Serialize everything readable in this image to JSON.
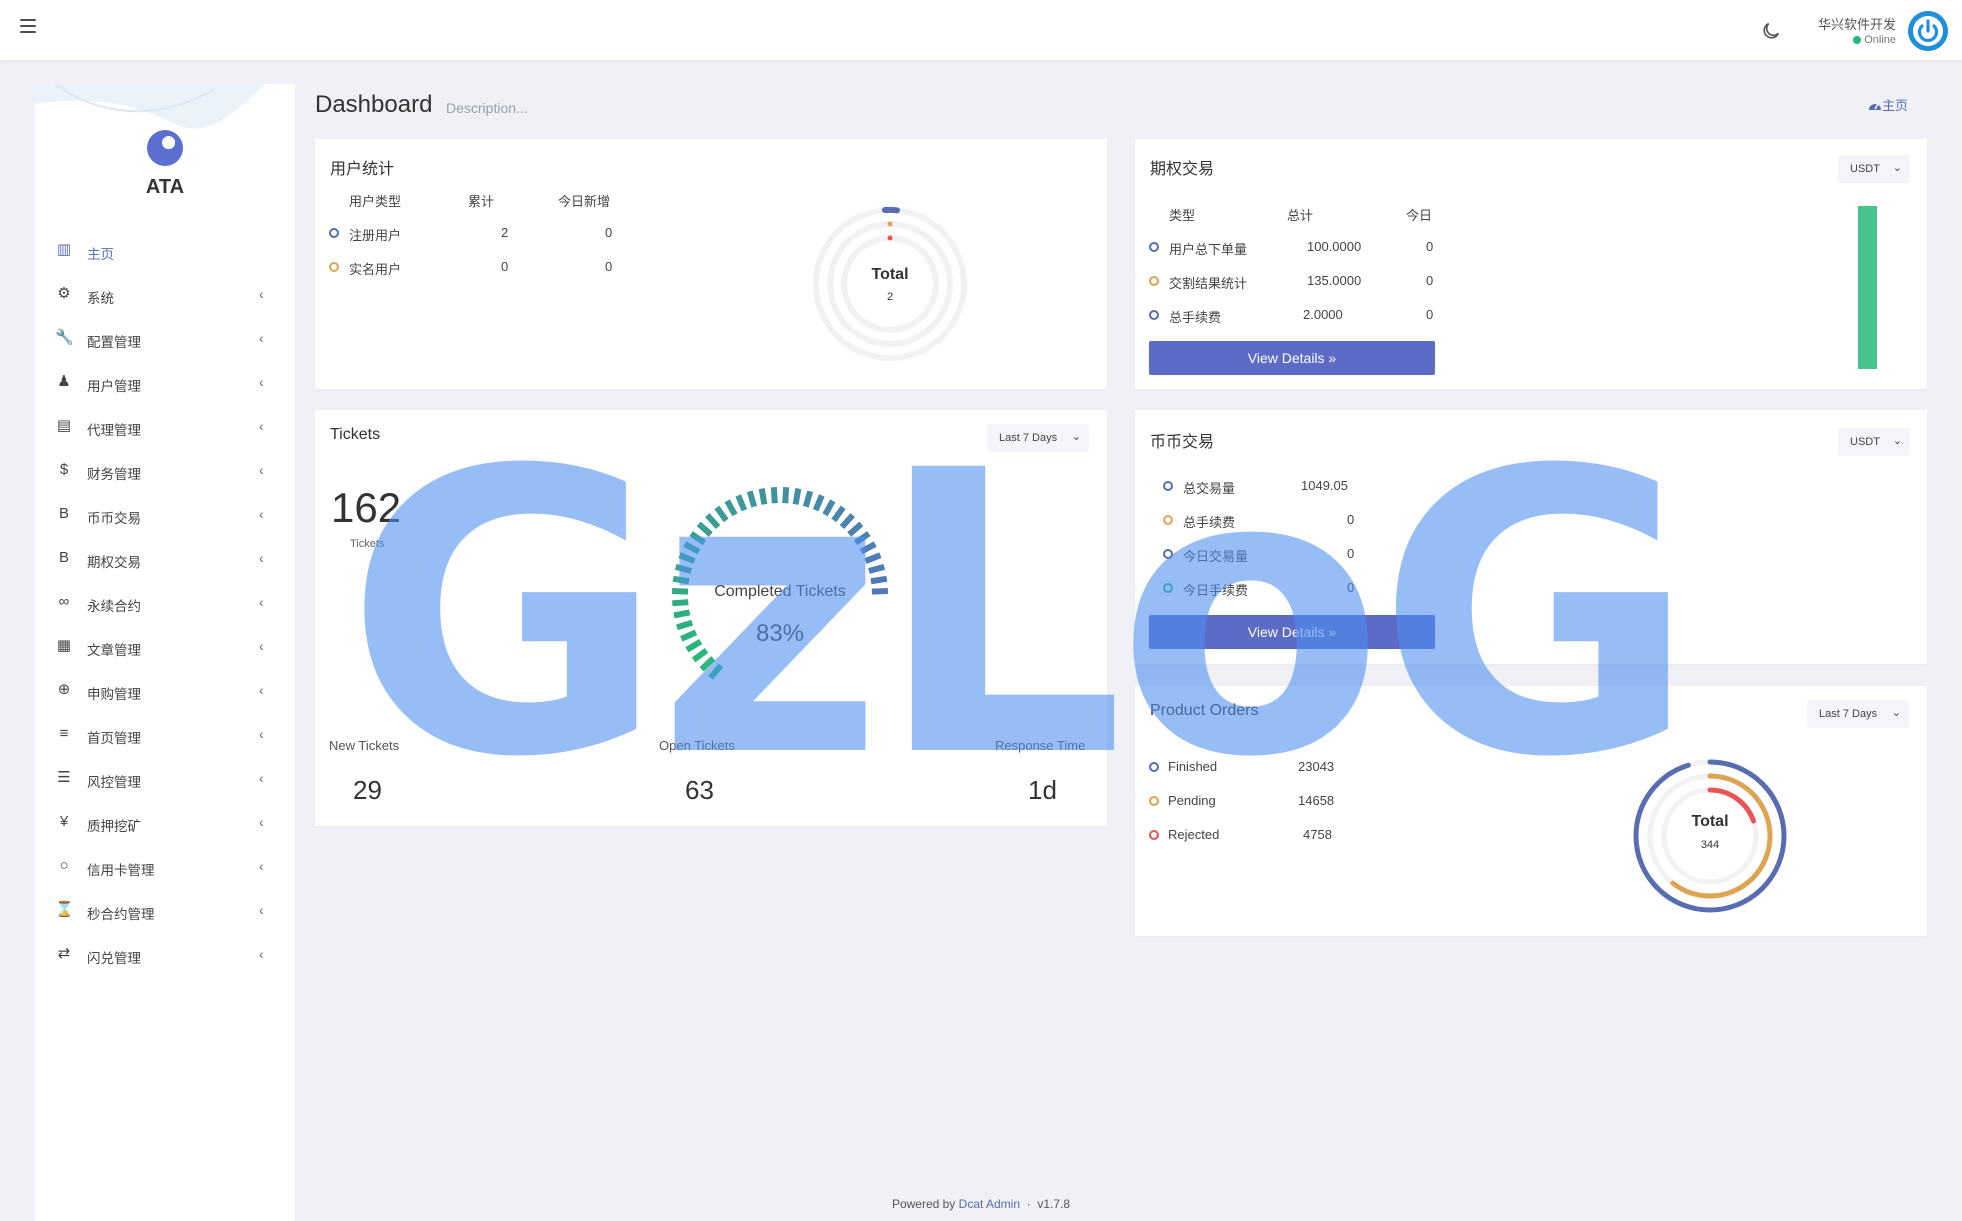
{
  "header": {
    "user_name": "华兴软件开发",
    "user_status": "Online"
  },
  "sidebar": {
    "brand": "ATA",
    "items": [
      {
        "label": "主页",
        "icon": "bar-chart-icon",
        "active": true
      },
      {
        "label": "系统",
        "icon": "gear-icon"
      },
      {
        "label": "配置管理",
        "icon": "wrench-icon"
      },
      {
        "label": "用户管理",
        "icon": "user-icon"
      },
      {
        "label": "代理管理",
        "icon": "id-card-icon"
      },
      {
        "label": "财务管理",
        "icon": "dollar-icon"
      },
      {
        "label": "币币交易",
        "icon": "bitcoin-icon"
      },
      {
        "label": "期权交易",
        "icon": "bitcoin-icon"
      },
      {
        "label": "永续合约",
        "icon": "link-icon"
      },
      {
        "label": "文章管理",
        "icon": "newspaper-icon"
      },
      {
        "label": "申购管理",
        "icon": "lifebuoy-icon"
      },
      {
        "label": "首页管理",
        "icon": "list-icon"
      },
      {
        "label": "风控管理",
        "icon": "indent-list-icon"
      },
      {
        "label": "质押挖矿",
        "icon": "yen-icon"
      },
      {
        "label": "信用卡管理",
        "icon": "circle-icon"
      },
      {
        "label": "秒合约管理",
        "icon": "hourglass-icon"
      },
      {
        "label": "闪兑管理",
        "icon": "exchange-icon"
      }
    ]
  },
  "page": {
    "title": "Dashboard",
    "description": "Description...",
    "breadcrumb": "主页"
  },
  "user_stats": {
    "title": "用户统计",
    "headers": [
      "用户类型",
      "累计",
      "今日新增"
    ],
    "rows": [
      {
        "type": "注册用户",
        "total": "2",
        "today": "0"
      },
      {
        "type": "实名用户",
        "total": "0",
        "today": "0"
      }
    ],
    "donut_label": "Total",
    "donut_value": "2"
  },
  "options_trade": {
    "title": "期权交易",
    "currency": "USDT",
    "headers": [
      "类型",
      "总计",
      "今日"
    ],
    "rows": [
      {
        "type": "用户总下单量",
        "total": "100.0000",
        "today": "0"
      },
      {
        "type": "交割结果统计",
        "total": "135.0000",
        "today": "0"
      },
      {
        "type": "总手续费",
        "total": "2.0000",
        "today": "0"
      }
    ],
    "button": "View Details",
    "bar_color": "#47c48b"
  },
  "tickets": {
    "title": "Tickets",
    "range": "Last 7 Days",
    "count": "162",
    "count_label": "Tickets",
    "gauge_label": "Completed Tickets",
    "gauge_value": "83%",
    "gauge_percent": 83,
    "stats": [
      {
        "label": "New Tickets",
        "value": "29"
      },
      {
        "label": "Open Tickets",
        "value": "63"
      },
      {
        "label": "Response Time",
        "value": "1d"
      }
    ]
  },
  "coin_trade": {
    "title": "币币交易",
    "currency": "USDT",
    "rows": [
      {
        "type": "总交易量",
        "value": "1049.05"
      },
      {
        "type": "总手续费",
        "value": "0"
      },
      {
        "type": "今日交易量",
        "value": "0"
      },
      {
        "type": "今日手续费",
        "value": "0"
      }
    ],
    "button": "View Details"
  },
  "product_orders": {
    "title": "Product Orders",
    "range": "Last 7 Days",
    "rows": [
      {
        "status": "Finished",
        "value": "23043",
        "color": "#586cb1"
      },
      {
        "status": "Pending",
        "value": "14658",
        "color": "#dda451"
      },
      {
        "status": "Rejected",
        "value": "4758",
        "color": "#ea5455"
      }
    ],
    "donut_label": "Total",
    "donut_value": "344"
  },
  "footer": {
    "prefix": "Powered by",
    "link": "Dcat Admin",
    "sep": "·",
    "version": "v1.7.8"
  },
  "watermark": "GzLoG",
  "colors": {
    "primary": "#586cb1",
    "button": "#5c6bc6",
    "success": "#21b978",
    "warning": "#dda451",
    "danger": "#ea5455",
    "watermark": "#4d8ff0"
  }
}
